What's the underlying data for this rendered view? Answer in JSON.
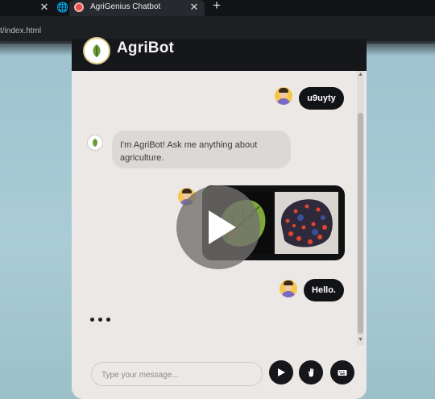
{
  "browser": {
    "active_tab_title": "AgriGenius Chatbot",
    "url_fragment": "t/index.html",
    "close_glyph": "✕",
    "new_tab_glyph": "+"
  },
  "chat": {
    "bot_name": "AgriBot",
    "messages": [
      {
        "sender": "user",
        "type": "text",
        "text": "u9uyty"
      },
      {
        "sender": "bot",
        "type": "text",
        "text": "I'm AgriBot! Ask me anything about agriculture."
      },
      {
        "sender": "user",
        "type": "image",
        "description_icon": "leaf-disease-images"
      },
      {
        "sender": "user",
        "type": "text",
        "text": "Hello."
      }
    ],
    "typing_indicator": true,
    "input": {
      "value": "",
      "placeholder": "Type your message..."
    },
    "buttons": {
      "send_icon": "send-icon",
      "gesture_icon": "hand-icon",
      "keyboard_icon": "keyboard-icon"
    }
  },
  "colors": {
    "header": "#16171a",
    "panel": "#ece8e5",
    "bot_bubble": "#dcd8d5",
    "user_bubble": "#121316"
  }
}
